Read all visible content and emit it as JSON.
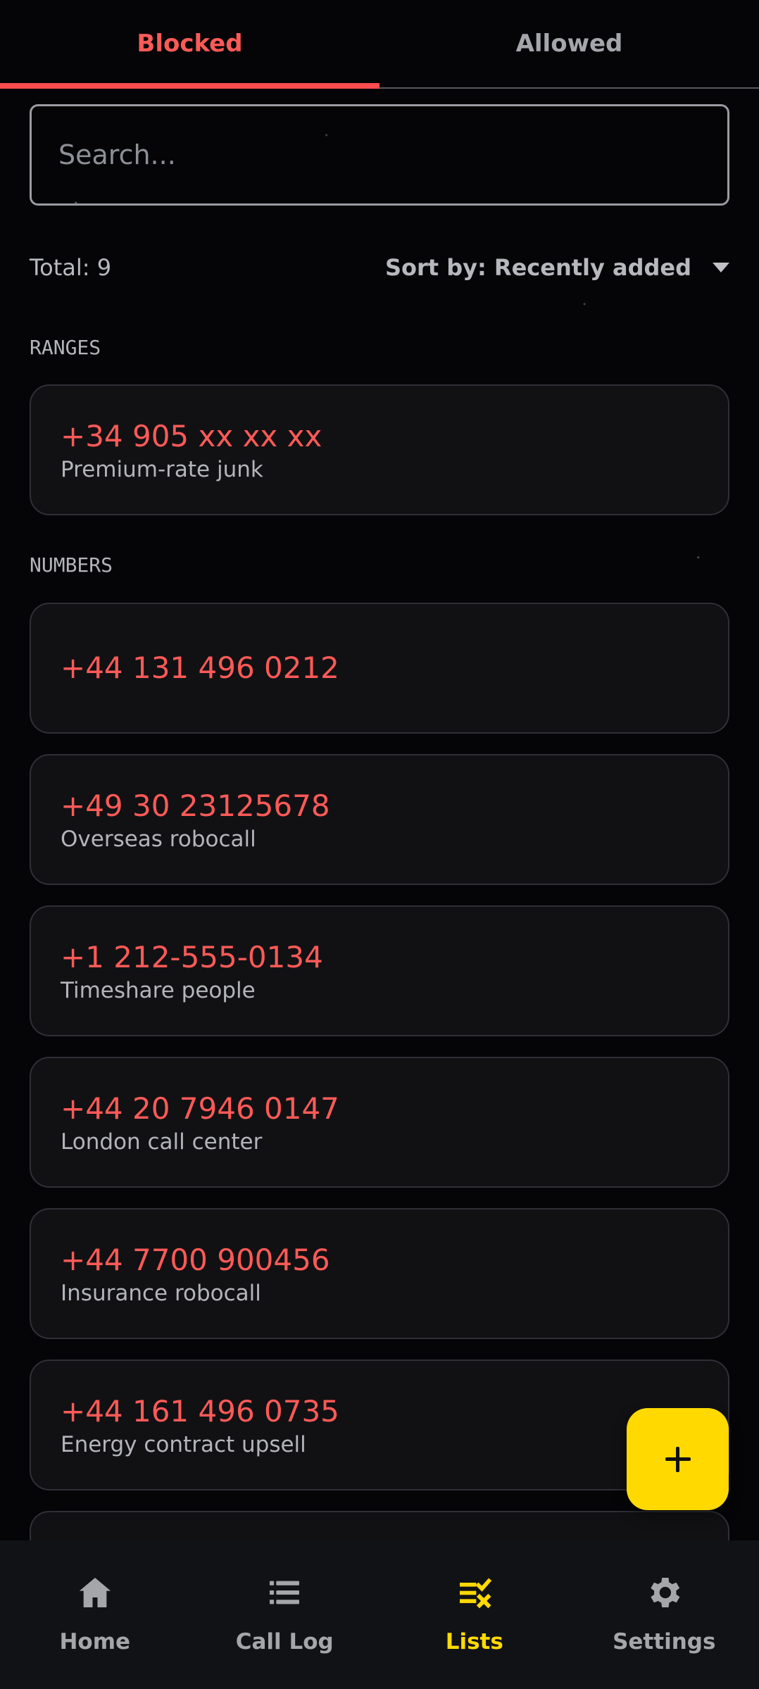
{
  "tabs": {
    "blocked": "Blocked",
    "allowed": "Allowed"
  },
  "search": {
    "placeholder": "Search..."
  },
  "summary": {
    "total": "Total: 9",
    "sort": "Sort by: Recently added"
  },
  "sections": {
    "ranges": "RANGES",
    "numbers": "NUMBERS"
  },
  "ranges": [
    {
      "number": "+34 905 xx xx xx",
      "label": "Premium-rate junk"
    }
  ],
  "numbers": [
    {
      "number": "+44 131 496 0212",
      "label": ""
    },
    {
      "number": "+49 30 23125678",
      "label": "Overseas robocall"
    },
    {
      "number": "+1 212-555-0134",
      "label": "Timeshare people"
    },
    {
      "number": "+44 20 7946 0147",
      "label": "London call center"
    },
    {
      "number": "+44 7700 900456",
      "label": "Insurance robocall"
    },
    {
      "number": "+44 161 496 0735",
      "label": "Energy contract upsell"
    }
  ],
  "nav": {
    "home": "Home",
    "call_log": "Call Log",
    "lists": "Lists",
    "settings": "Settings"
  },
  "colors": {
    "accent_red": "#ff5a57",
    "accent_yellow": "#ffd900",
    "background": "#050507"
  },
  "icons": {
    "add": "plus-icon",
    "home": "home-icon",
    "call_log": "list-icon",
    "lists": "lists-icon",
    "settings": "gear-icon"
  }
}
